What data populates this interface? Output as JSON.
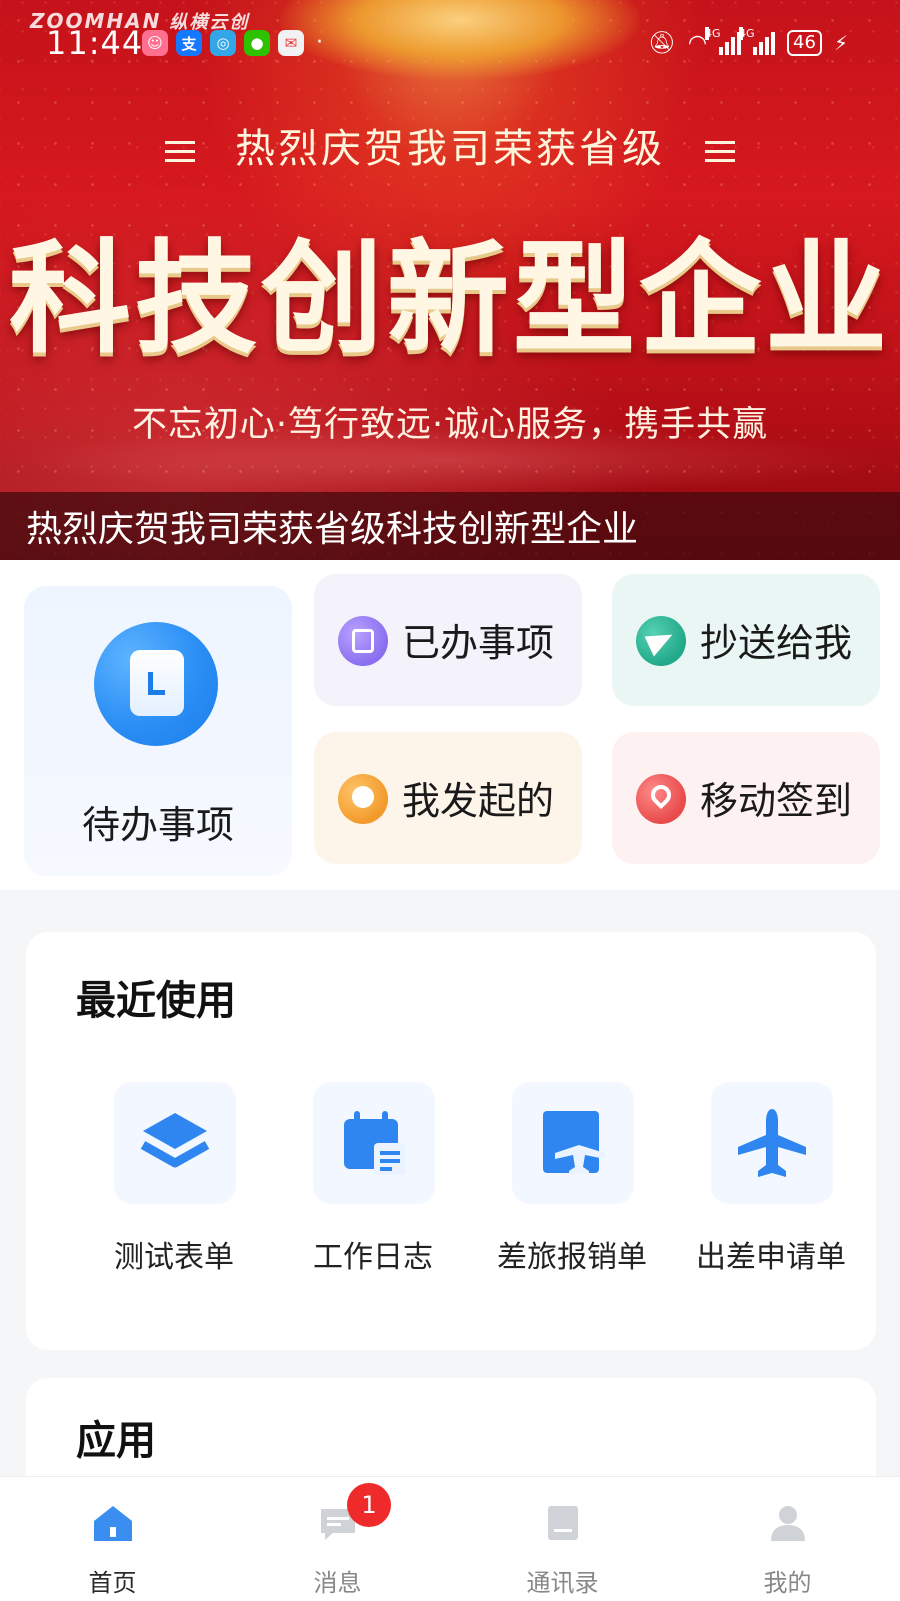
{
  "status_bar": {
    "time": "11:44",
    "battery": "46",
    "signal_1_label": "4G",
    "signal_2_label": "4G",
    "notification_icons": [
      "avatar-app-icon",
      "alipay-icon",
      "browser-icon",
      "wechat-icon",
      "mail-icon"
    ]
  },
  "banner": {
    "brand": "ZOOMHAN",
    "brand_cn": "纵横云创",
    "headline": "热烈庆贺我司荣获省级",
    "big_title": "科技创新型企业",
    "slogan": "不忘初心·笃行致远·诚心服务，携手共赢",
    "caption": "热烈庆贺我司荣获省级科技创新型企业"
  },
  "quick_actions": {
    "todo": "待办事项",
    "done": "已办事项",
    "cc": "抄送给我",
    "initiated": "我发起的",
    "checkin": "移动签到"
  },
  "recent": {
    "title": "最近使用",
    "items": [
      {
        "label": "测试表单",
        "icon": "layers-icon"
      },
      {
        "label": "工作日志",
        "icon": "calendar-log-icon"
      },
      {
        "label": "差旅报销单",
        "icon": "travel-reimburse-icon"
      },
      {
        "label": "出差申请单",
        "icon": "airplane-icon"
      }
    ]
  },
  "apps": {
    "title": "应用"
  },
  "bottom_nav": {
    "items": [
      {
        "label": "首页",
        "icon": "home-icon",
        "active": true
      },
      {
        "label": "消息",
        "icon": "message-icon",
        "badge": "1"
      },
      {
        "label": "通讯录",
        "icon": "contacts-icon"
      },
      {
        "label": "我的",
        "icon": "profile-icon"
      }
    ]
  },
  "colors": {
    "banner_red": "#c5121a",
    "accent_blue": "#2a8ef5",
    "badge_red": "#ee2a2a"
  }
}
